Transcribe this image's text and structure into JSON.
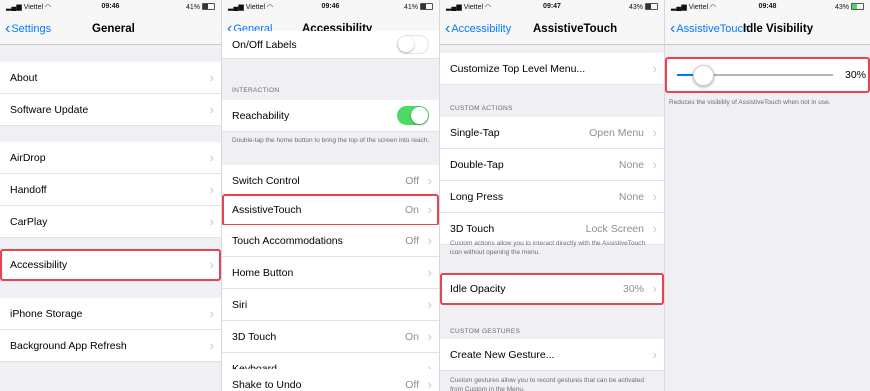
{
  "screens": [
    {
      "status": {
        "carrier": "Viettel",
        "time": "09:46",
        "battery": "41%"
      },
      "nav": {
        "back": "Settings",
        "title": "General"
      },
      "rows": [
        {
          "label": "About"
        },
        {
          "label": "Software Update"
        },
        {
          "label": "AirDrop"
        },
        {
          "label": "Handoff"
        },
        {
          "label": "CarPlay"
        },
        {
          "label": "Accessibility"
        },
        {
          "label": "iPhone Storage"
        },
        {
          "label": "Background App Refresh"
        }
      ]
    },
    {
      "status": {
        "carrier": "Viettel",
        "time": "09:46",
        "battery": "41%"
      },
      "nav": {
        "back": "General",
        "title": "Accessibility"
      },
      "rows": [
        {
          "label": "On/Off Labels"
        },
        {
          "label": "Reachability"
        },
        {
          "label": "Switch Control",
          "value": "Off"
        },
        {
          "label": "AssistiveTouch",
          "value": "On"
        },
        {
          "label": "Touch Accommodations",
          "value": "Off"
        },
        {
          "label": "Home Button"
        },
        {
          "label": "Siri"
        },
        {
          "label": "3D Touch",
          "value": "On"
        },
        {
          "label": "Keyboard"
        },
        {
          "label": "Shake to Undo",
          "value": "Off"
        }
      ],
      "header_interaction": "INTERACTION",
      "footer_reachability": "Double-tap the home button to bring the top of the screen into reach."
    },
    {
      "status": {
        "carrier": "Viettel",
        "time": "09:47",
        "battery": "43%"
      },
      "nav": {
        "back": "Accessibility",
        "title": "AssistiveTouch"
      },
      "rows": [
        {
          "label": "Customize Top Level Menu..."
        },
        {
          "label": "Single-Tap",
          "value": "Open Menu"
        },
        {
          "label": "Double-Tap",
          "value": "None"
        },
        {
          "label": "Long Press",
          "value": "None"
        },
        {
          "label": "3D Touch",
          "value": "Lock Screen"
        },
        {
          "label": "Idle Opacity",
          "value": "30%"
        },
        {
          "label": "Create New Gesture..."
        }
      ],
      "header_custom_actions": "CUSTOM ACTIONS",
      "footer_custom_actions": "Custom actions allow you to interact directly with the AssistiveTouch icon without opening the menu.",
      "header_custom_gestures": "CUSTOM GESTURES",
      "footer_custom_gestures": "Custom gestures allow you to record gestures that can be activated from Custom in the Menu."
    },
    {
      "status": {
        "carrier": "Viettel",
        "time": "09:48",
        "battery": "43%"
      },
      "nav": {
        "back": "AssistiveTouch",
        "title": "Idle Visibility"
      },
      "slider": {
        "value_label": "30%",
        "value": 0.3
      },
      "footer": "Reduces the visibility of AssistiveTouch when not in use."
    }
  ],
  "colors": {
    "accent": "#007aff",
    "highlight": "#e8424f",
    "toggle_on": "#4cd964"
  }
}
